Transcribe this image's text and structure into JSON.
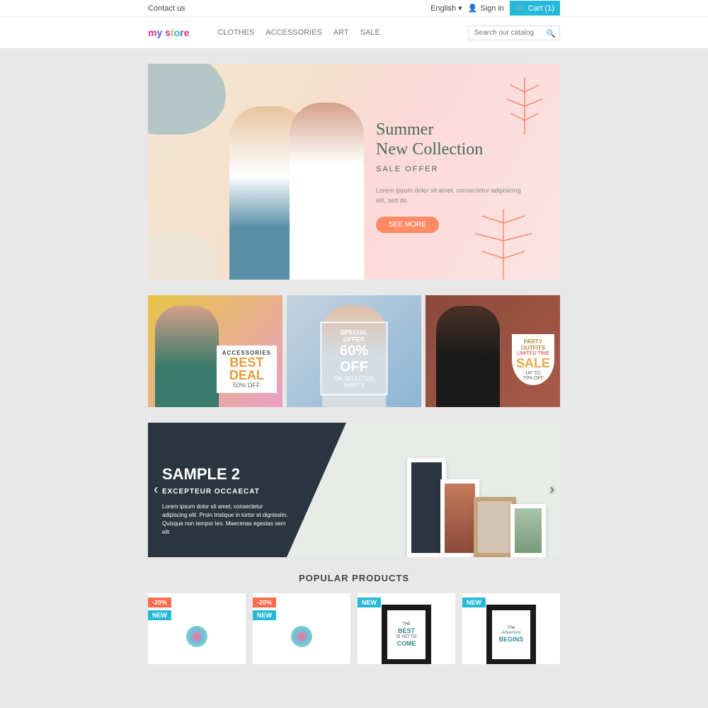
{
  "topbar": {
    "contact": "Contact us",
    "language": "English",
    "signin": "Sign in",
    "cart": "Cart (1)"
  },
  "logo": {
    "text": "my store"
  },
  "nav": [
    "CLOTHES",
    "ACCESSORIES",
    "ART",
    "SALE"
  ],
  "search": {
    "placeholder": "Search our catalog"
  },
  "hero": {
    "title1": "Summer",
    "title2": "New Collection",
    "subtitle": "SALE OFFER",
    "lorem": "Lorem ipsum dolor sit amet, consectetur adipisicing elit, sed do",
    "button": "SEE MORE"
  },
  "promos": {
    "p1": {
      "label": "ACCESSORIES",
      "deal1": "BEST",
      "deal2": "DEAL",
      "pct": "50% OFF"
    },
    "p2": {
      "label": "SPECIAL OFFER",
      "pct": "60% OFF",
      "sub": "ON SELECTED SHIRTS"
    },
    "p3": {
      "t1": "PARTY",
      "t2": "OUTFITS",
      "limited": "LIMITED TIME",
      "sale": "SALE",
      "up": "UP TO",
      "pct": "70% OFF"
    }
  },
  "carousel": {
    "title": "SAMPLE 2",
    "subtitle": "EXCEPTEUR OCCAECAT",
    "desc": "Lorem ipsum dolor sit amet, consectetur adipiscing elit. Proin tristique in tortor et dignissim. Quisque non tempor leo. Maecenas egestas sem elit"
  },
  "popular": {
    "title": "POPULAR PRODUCTS"
  },
  "products": [
    {
      "discount": "-20%",
      "new": "NEW"
    },
    {
      "discount": "-20%",
      "new": "NEW"
    },
    {
      "new": "NEW",
      "poster": {
        "l1": "THE",
        "l2": "BEST",
        "l3": "IS YET TO",
        "l4": "COME"
      }
    },
    {
      "new": "NEW",
      "poster": {
        "l1": "The",
        "l2": "Adventure",
        "l3": "BEGINS"
      }
    }
  ]
}
